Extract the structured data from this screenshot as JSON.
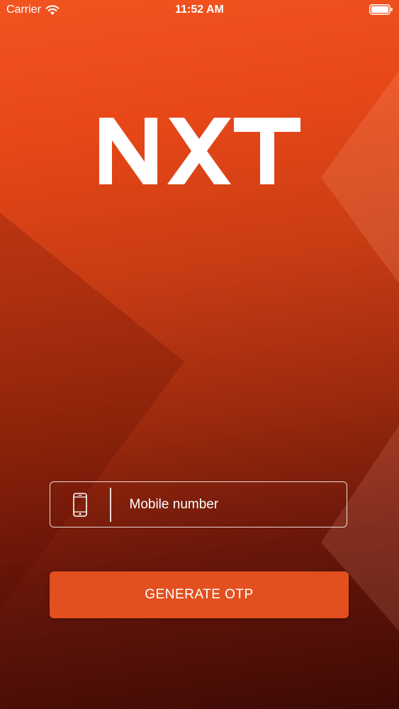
{
  "status_bar": {
    "carrier": "Carrier",
    "time": "11:52 AM",
    "wifi_icon": "wifi-icon",
    "battery_icon": "battery-icon"
  },
  "logo": {
    "text": "NXT"
  },
  "login": {
    "mobile_placeholder": "Mobile number",
    "mobile_value": "",
    "phone_icon": "mobile-phone-icon",
    "generate_label": "GENERATE OTP"
  },
  "colors": {
    "background_top": "#f25420",
    "background_bottom": "#3d0a05",
    "button": "#e2501f",
    "text": "#ffffff"
  }
}
